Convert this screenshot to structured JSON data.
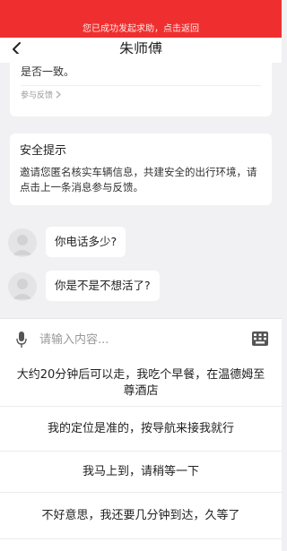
{
  "sos_banner": {
    "text": "您已成功发起求助，点击返回",
    "color": "#ef2f2f"
  },
  "header": {
    "title": "朱师傅"
  },
  "chat": {
    "card_partial": {
      "top_line_fragment": "",
      "text": "是否一致。",
      "feedback_label": "参与反馈"
    },
    "safety_card": {
      "title": "安全提示",
      "body": "邀请您匿名核实车辆信息，共建安全的出行环境，请点击上一条消息参与反馈。"
    },
    "messages": [
      {
        "text": "你电话多少?"
      },
      {
        "text": "你是不是不想活了?"
      }
    ]
  },
  "input_bar": {
    "placeholder": "请输入内容..."
  },
  "quick_replies": [
    "大约20分钟后可以走，我吃个早餐，在温德姆至尊酒店",
    "我的定位是准的，按导航来接我就行",
    "我马上到，请稍等一下",
    "不好意思，我还要几分钟到达，久等了"
  ]
}
